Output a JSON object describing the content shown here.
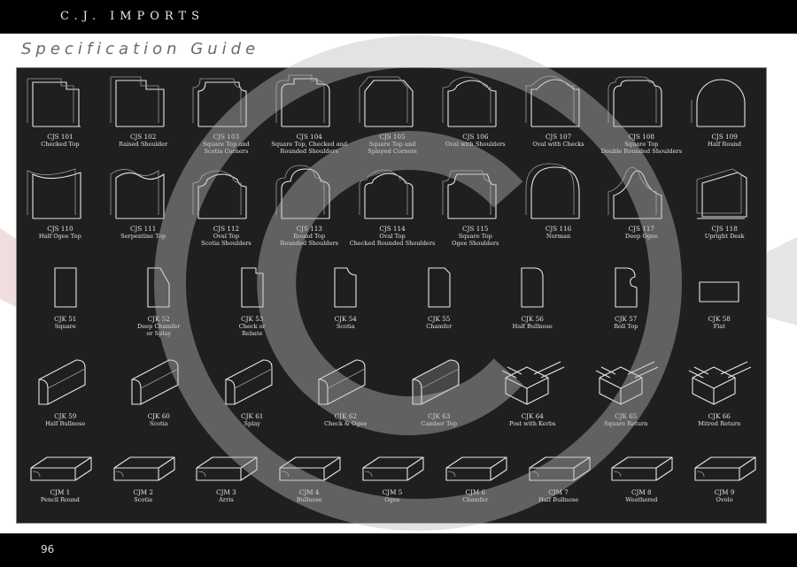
{
  "header": {
    "brand": "C.J. IMPORTS"
  },
  "page": {
    "subtitle": "Specification Guide",
    "page_number": "96"
  },
  "rows": [
    {
      "kind": "headstone",
      "items": [
        {
          "code": "CJS 101",
          "name": "Checked Top",
          "shape": "checked-top"
        },
        {
          "code": "CJS 102",
          "name": "Raised Shoulder",
          "shape": "raised-shoulder"
        },
        {
          "code": "CJS 103",
          "name": "Square Top and\nScotia Corners",
          "shape": "scotia-corners"
        },
        {
          "code": "CJS 104",
          "name": "Square Top, Checked and\nRounded Shoulders",
          "shape": "checked-rounded"
        },
        {
          "code": "CJS 105",
          "name": "Square Top and\nSplayed Corners",
          "shape": "splayed-corners"
        },
        {
          "code": "CJS 106",
          "name": "Oval with Shoulders",
          "shape": "oval-shoulders"
        },
        {
          "code": "CJS 107",
          "name": "Oval with Checks",
          "shape": "oval-checks"
        },
        {
          "code": "CJS 108",
          "name": "Square Top\nDouble Rounded Shoulders",
          "shape": "double-rounded"
        },
        {
          "code": "CJS 109",
          "name": "Half Round",
          "shape": "half-round"
        }
      ]
    },
    {
      "kind": "headstone",
      "items": [
        {
          "code": "CJS 110",
          "name": "Half Ogee Top",
          "shape": "half-ogee"
        },
        {
          "code": "CJS 111",
          "name": "Serpentine Top",
          "shape": "serpentine"
        },
        {
          "code": "CJS 112",
          "name": "Oval Top\nScotia Shoulders",
          "shape": "oval-scotia"
        },
        {
          "code": "CJS 113",
          "name": "Round Top\nRounded Shoulders",
          "shape": "round-rounded"
        },
        {
          "code": "CJS 114",
          "name": "Oval Top\nChecked Rounded Shoulders",
          "shape": "oval-checked-rounded"
        },
        {
          "code": "CJS 115",
          "name": "Square Top\nOgee Shoulders",
          "shape": "ogee-shoulders"
        },
        {
          "code": "CJS 116",
          "name": "Norman",
          "shape": "norman"
        },
        {
          "code": "CJS 117",
          "name": "Deep Ogee",
          "shape": "deep-ogee"
        },
        {
          "code": "CJS 118",
          "name": "Upright Desk",
          "shape": "upright-desk"
        }
      ]
    },
    {
      "kind": "profile",
      "items": [
        {
          "code": "CJK 51",
          "name": "Square",
          "shape": "square"
        },
        {
          "code": "CJK 52",
          "name": "Deep Chamfer\nor Splay",
          "shape": "deep-chamfer"
        },
        {
          "code": "CJK 53",
          "name": "Check or\nRebate",
          "shape": "check-rebate"
        },
        {
          "code": "CJK 54",
          "name": "Scotia",
          "shape": "scotia"
        },
        {
          "code": "CJK 55",
          "name": "Chamfer",
          "shape": "chamfer"
        },
        {
          "code": "CJK 56",
          "name": "Half Bullnose",
          "shape": "half-bullnose"
        },
        {
          "code": "CJK 57",
          "name": "Roll Top",
          "shape": "roll-top"
        },
        {
          "code": "CJK 58",
          "name": "Flat",
          "shape": "flat"
        }
      ]
    },
    {
      "kind": "kerb",
      "items": [
        {
          "code": "CJK 59",
          "name": "Half Bullnose",
          "shape": "kerb-bullnose"
        },
        {
          "code": "CJK 60",
          "name": "Scotia",
          "shape": "kerb-scotia"
        },
        {
          "code": "CJK 61",
          "name": "Splay",
          "shape": "kerb-splay"
        },
        {
          "code": "CJK 62",
          "name": "Check & Ogee",
          "shape": "kerb-ogee"
        },
        {
          "code": "CJK 63",
          "name": "Camber Top",
          "shape": "kerb-camber"
        },
        {
          "code": "CJK 64",
          "name": "Post with Kerbs",
          "shape": "post-kerbs"
        },
        {
          "code": "CJK 65",
          "name": "Square Return",
          "shape": "square-return"
        },
        {
          "code": "CJK 66",
          "name": "Mitred Return",
          "shape": "mitred-return"
        }
      ]
    },
    {
      "kind": "slab",
      "items": [
        {
          "code": "CJM 1",
          "name": "Pencil Round",
          "shape": "pencil-round"
        },
        {
          "code": "CJM 2",
          "name": "Scotia",
          "shape": "slab-scotia"
        },
        {
          "code": "CJM 3",
          "name": "Arris",
          "shape": "arris"
        },
        {
          "code": "CJM 4",
          "name": "Bullnose",
          "shape": "bullnose"
        },
        {
          "code": "CJM 5",
          "name": "Ogee",
          "shape": "ogee"
        },
        {
          "code": "CJM 6",
          "name": "Chamfer",
          "shape": "slab-chamfer"
        },
        {
          "code": "CJM 7",
          "name": "Half Bullnose",
          "shape": "slab-half-bullnose"
        },
        {
          "code": "CJM 8",
          "name": "Weathered",
          "shape": "weathered"
        },
        {
          "code": "CJM 9",
          "name": "Ovolo",
          "shape": "ovolo"
        }
      ]
    }
  ],
  "colors": {
    "panel": "#1f1f1f",
    "line": "#e6e6e6",
    "watermark": "#bdbdbd"
  }
}
